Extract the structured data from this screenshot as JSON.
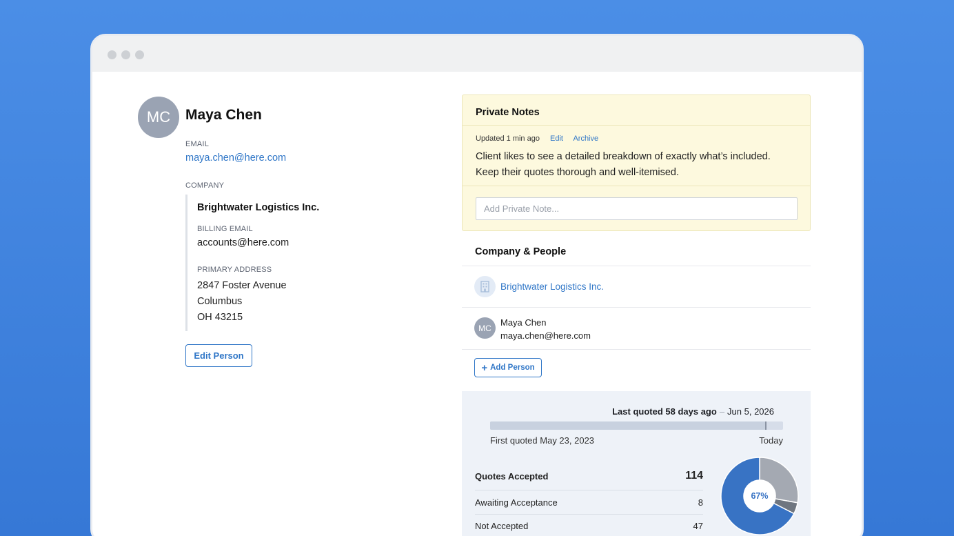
{
  "person": {
    "initials": "MC",
    "name": "Maya Chen",
    "email_label": "EMAIL",
    "email": "maya.chen@here.com",
    "company_label": "COMPANY",
    "company_name": "Brightwater Logistics Inc.",
    "billing_email_label": "BILLING EMAIL",
    "billing_email": "accounts@here.com",
    "address_label": "PRIMARY ADDRESS",
    "address_line1": "2847 Foster Avenue",
    "address_line2": "Columbus",
    "address_line3": "OH 43215",
    "edit_label": "Edit Person"
  },
  "notes": {
    "title": "Private Notes",
    "updated": "Updated 1 min ago",
    "edit_label": "Edit",
    "archive_label": "Archive",
    "body_line1": "Client likes to see a detailed breakdown of exactly what’s included.",
    "body_line2": "Keep their quotes thorough and well-itemised.",
    "input_placeholder": "Add Private Note..."
  },
  "company_people": {
    "title": "Company & People",
    "company_name": "Brightwater Logistics Inc.",
    "person_initials": "MC",
    "person_name": "Maya Chen",
    "person_email": "maya.chen@here.com",
    "add_label": "Add Person",
    "add_icon": "+"
  },
  "quote_stats": {
    "last_quoted_label": "Last quoted 58 days ago",
    "separator": "–",
    "last_quoted_date": "Jun 5, 2026",
    "first_quoted": "First quoted May 23, 2023",
    "today_label": "Today",
    "timeline_fraction": 0.94,
    "accepted_label": "Quotes Accepted",
    "accepted_value": "114",
    "awaiting_label": "Awaiting Acceptance",
    "awaiting_value": "8",
    "not_accepted_label": "Not Accepted",
    "not_accepted_value": "47",
    "donut_center": "67%"
  },
  "chart_data": {
    "type": "pie",
    "categories": [
      "Quotes Accepted",
      "Awaiting Acceptance",
      "Not Accepted"
    ],
    "values": [
      114,
      8,
      47
    ],
    "colors": [
      "#3873c4",
      "#6f7680",
      "#a4a9b2"
    ],
    "center_label": "67%"
  },
  "colors": {
    "accent": "#2f76c7",
    "notes_bg": "#fdf9de",
    "stats_bg": "#eef2f8"
  }
}
